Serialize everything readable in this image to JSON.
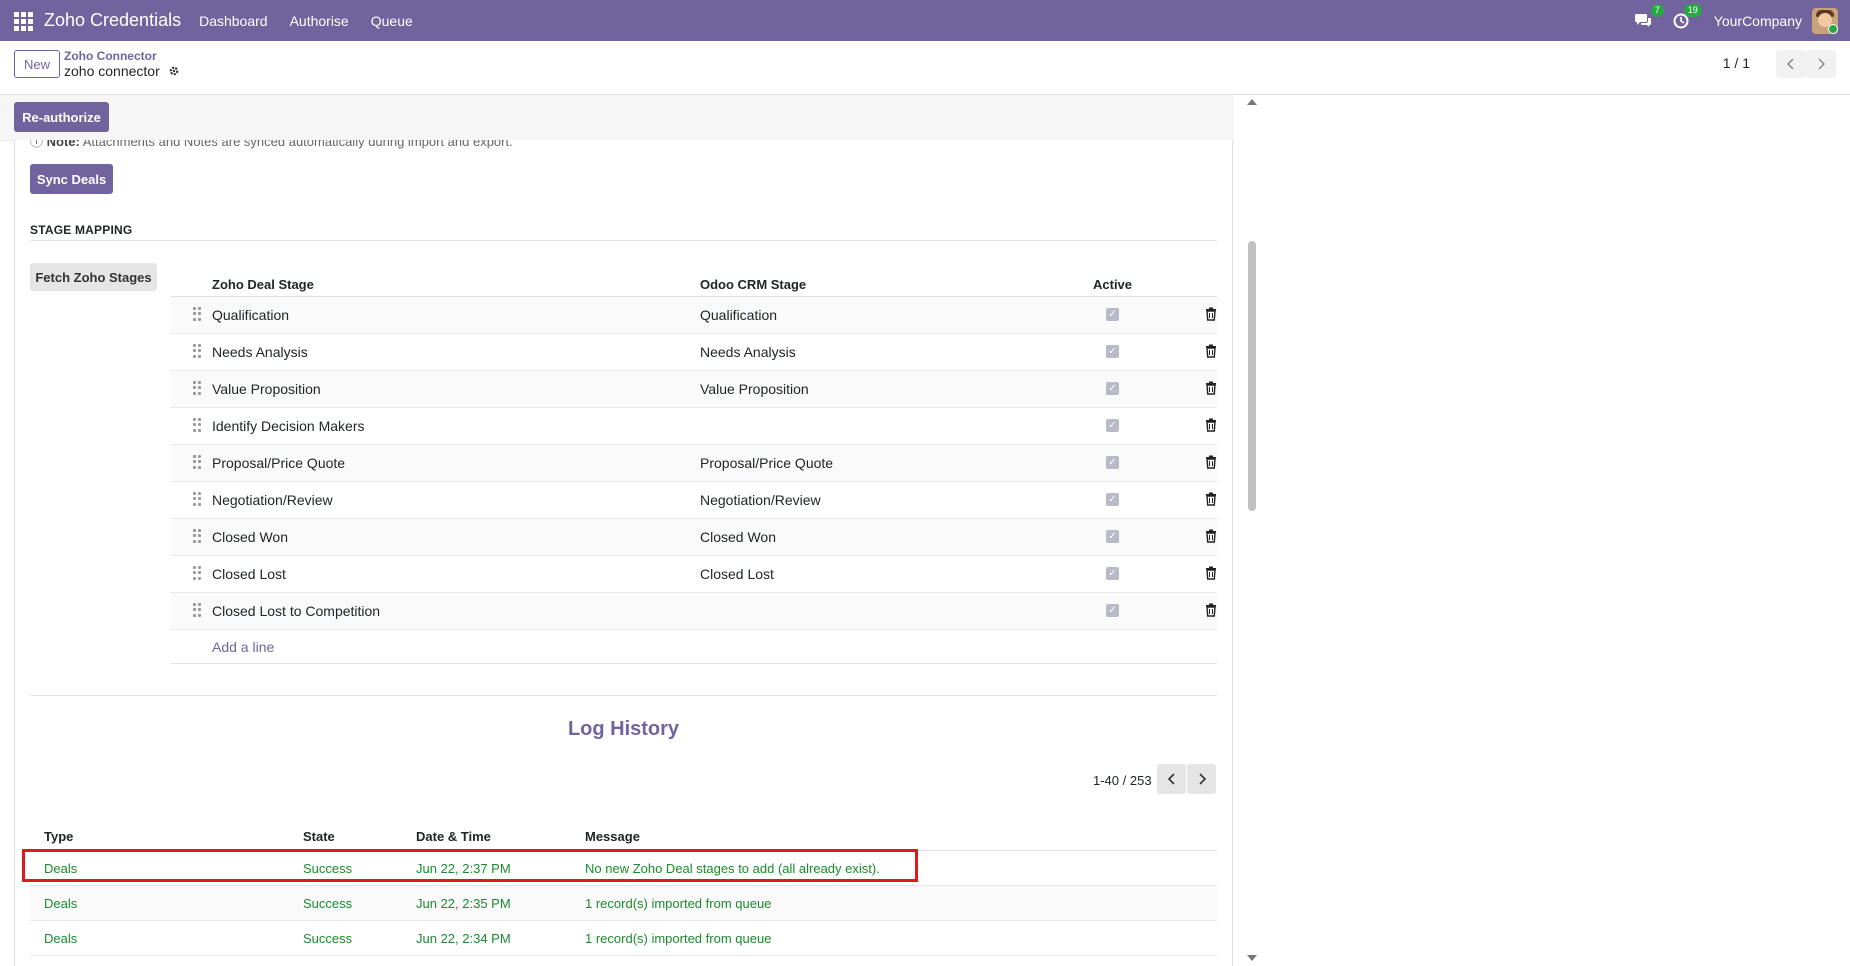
{
  "navbar": {
    "brand": "Zoho Credentials",
    "menu": [
      "Dashboard",
      "Authorise",
      "Queue"
    ],
    "messages_count": "7",
    "activities_count": "19",
    "company": "YourCompany"
  },
  "control": {
    "new_label": "New",
    "breadcrumb_parent": "Zoho Connector",
    "breadcrumb_current": "zoho connector",
    "pager": "1 / 1"
  },
  "actions": {
    "reauthorize_label": "Re-authorize",
    "note_label": "Note:",
    "note_text": "Attachments and Notes are synced automatically during import and export.",
    "sync_deals_label": "Sync Deals",
    "fetch_stages_label": "Fetch Zoho Stages"
  },
  "stage_mapping": {
    "title": "STAGE MAPPING",
    "headers": {
      "zoho": "Zoho Deal Stage",
      "odoo": "Odoo CRM Stage",
      "active": "Active"
    },
    "rows": [
      {
        "zoho": "Qualification",
        "odoo": "Qualification",
        "active": true
      },
      {
        "zoho": "Needs Analysis",
        "odoo": "Needs Analysis",
        "active": true
      },
      {
        "zoho": "Value Proposition",
        "odoo": "Value Proposition",
        "active": true
      },
      {
        "zoho": "Identify Decision Makers",
        "odoo": "",
        "active": true
      },
      {
        "zoho": "Proposal/Price Quote",
        "odoo": "Proposal/Price Quote",
        "active": true
      },
      {
        "zoho": "Negotiation/Review",
        "odoo": "Negotiation/Review",
        "active": true
      },
      {
        "zoho": "Closed Won",
        "odoo": "Closed Won",
        "active": true
      },
      {
        "zoho": "Closed Lost",
        "odoo": "Closed Lost",
        "active": true
      },
      {
        "zoho": "Closed Lost to Competition",
        "odoo": "",
        "active": true
      }
    ],
    "add_line_label": "Add a line"
  },
  "log_history": {
    "title": "Log History",
    "pager": "1-40 / 253",
    "headers": {
      "type": "Type",
      "state": "State",
      "date": "Date & Time",
      "message": "Message"
    },
    "rows": [
      {
        "type": "Deals",
        "state": "Success",
        "date": "Jun 22, 2:37 PM",
        "message": "No new Zoho Deal stages to add (all already exist)."
      },
      {
        "type": "Deals",
        "state": "Success",
        "date": "Jun 22, 2:35 PM",
        "message": "1 record(s) imported from queue"
      },
      {
        "type": "Deals",
        "state": "Success",
        "date": "Jun 22, 2:34 PM",
        "message": "1 record(s) imported from queue"
      }
    ]
  },
  "colors": {
    "brand": "#71639e",
    "success": "#1a8a2e",
    "highlight": "#e0191d"
  }
}
